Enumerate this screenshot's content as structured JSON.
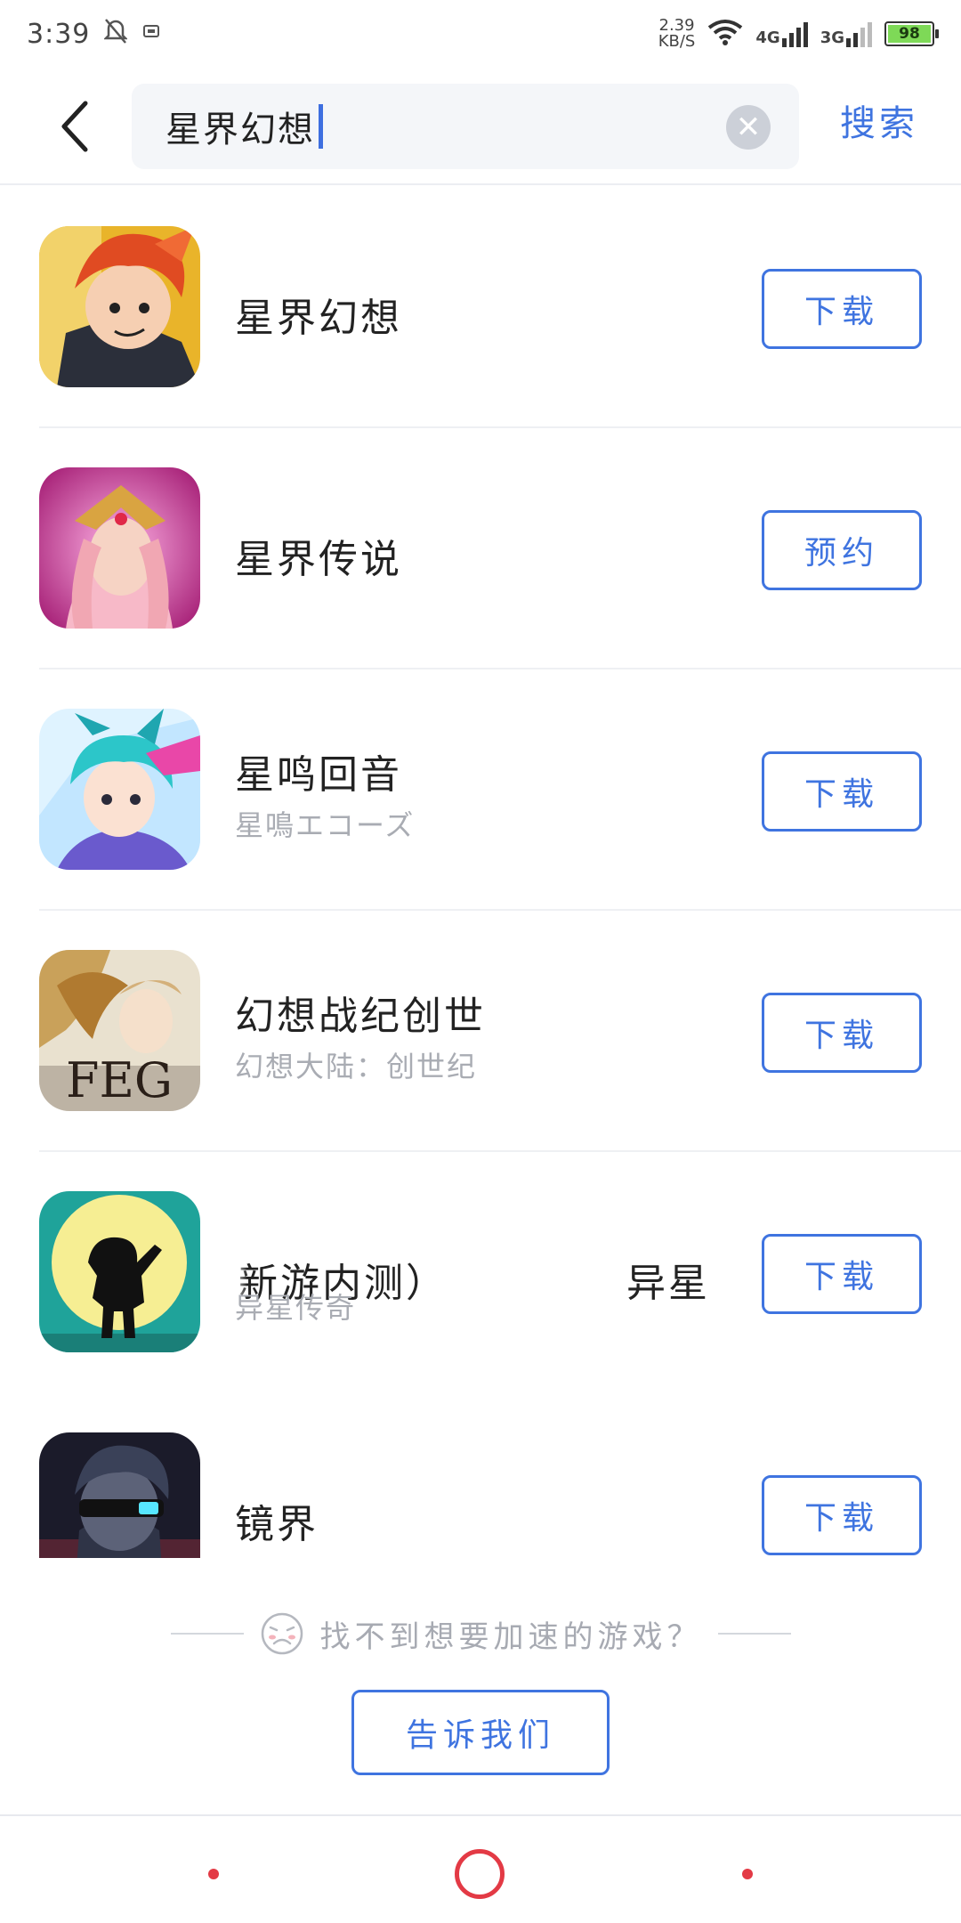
{
  "status_bar": {
    "time": "3:39",
    "speed_value": "2.39",
    "speed_unit": "KB/S",
    "net1": "4G",
    "net2": "3G",
    "battery": "98"
  },
  "search": {
    "query": "星界幻想",
    "submit_label": "搜索"
  },
  "results": [
    {
      "name": "星界幻想",
      "subtitle": "",
      "action": "下载",
      "icon": "game-icon-red-hair-hero"
    },
    {
      "name": "星界传说",
      "subtitle": "",
      "action": "预约",
      "icon": "game-icon-pink-goddess"
    },
    {
      "name": "星鸣回音",
      "subtitle": "星鳴エコーズ",
      "action": "下载",
      "icon": "game-icon-anime-boy"
    },
    {
      "name": "幻想战纪创世",
      "subtitle": "幻想大陆：创世纪",
      "action": "下载",
      "icon": "game-icon-feg"
    },
    {
      "name": "新游内测）",
      "name_scroll": "异星",
      "subtitle": "异星传奇",
      "action": "下载",
      "icon": "game-icon-moon-silhouette"
    },
    {
      "name": "镜界",
      "subtitle": "",
      "action": "下载",
      "icon": "game-icon-cyber-warrior"
    }
  ],
  "footer": {
    "not_found_text": "找不到想要加速的游戏？",
    "tell_us_label": "告诉我们"
  },
  "colors": {
    "accent": "#3f74e0",
    "nav": "#e33a45"
  }
}
